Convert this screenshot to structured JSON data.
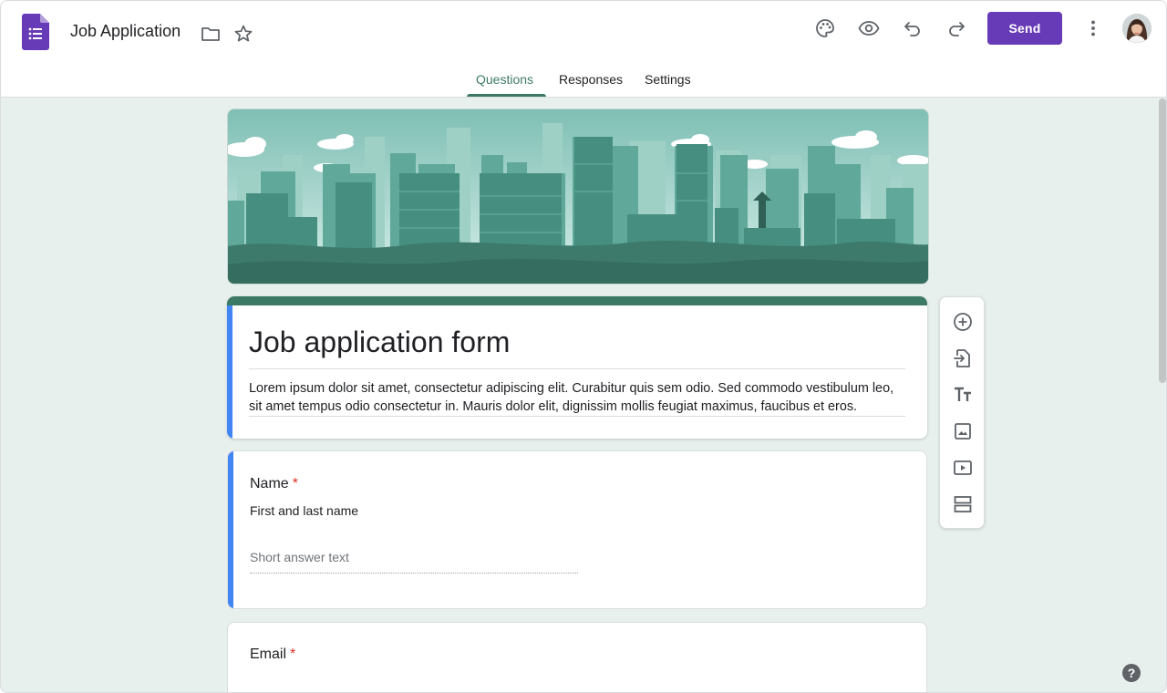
{
  "header": {
    "doc_title": "Job Application",
    "send_label": "Send",
    "icons": [
      "forms-logo-icon",
      "folder-icon",
      "star-icon",
      "palette-icon",
      "preview-eye-icon",
      "undo-icon",
      "redo-icon",
      "more-vert-icon",
      "avatar"
    ]
  },
  "tabs": [
    {
      "label": "Questions",
      "active": true
    },
    {
      "label": "Responses",
      "active": false
    },
    {
      "label": "Settings",
      "active": false
    }
  ],
  "form": {
    "title": "Job application form",
    "description": "Lorem ipsum dolor sit amet, consectetur adipiscing elit. Curabitur quis sem odio. Sed commodo vestibulum leo, sit amet tempus odio consectetur in. Mauris dolor elit, dignissim mollis feugiat maximus, faucibus et eros."
  },
  "questions": [
    {
      "title": "Name",
      "required_mark": "*",
      "description": "First and last name",
      "placeholder": "Short answer text"
    },
    {
      "title": "Email",
      "required_mark": "*"
    }
  ],
  "toolbar": [
    "add-question-icon",
    "import-questions-icon",
    "add-title-icon",
    "add-image-icon",
    "add-video-icon",
    "add-section-icon"
  ],
  "help": "?",
  "colors": {
    "accent": "#3d7a66",
    "send": "#673ab7",
    "active_bar": "#4285f4",
    "background": "#e8f0ed",
    "required": "#d93025"
  }
}
